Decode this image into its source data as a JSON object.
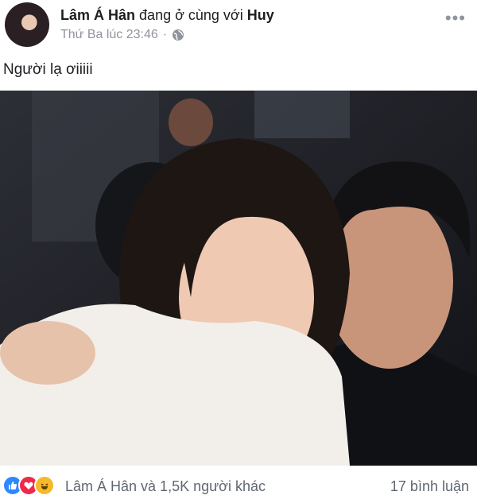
{
  "post": {
    "author": "Lâm Á Hân",
    "activity": "đang ở cùng với",
    "tagged": "Huy",
    "timestamp": "Thứ Ba lúc 23:46",
    "separator": "·",
    "privacy_icon": "globe-icon",
    "more_label": "•••",
    "text": "Người lạ ơiiiii"
  },
  "footer": {
    "reaction_icons": [
      "like-icon",
      "love-icon",
      "haha-icon"
    ],
    "reactions_summary": "Lâm Á Hân và 1,5K người khác",
    "comments": "17 bình luận"
  },
  "colors": {
    "like": "#2d88ff",
    "love": "#f0284a",
    "haha": "#f7b928",
    "meta_gray": "#90949c"
  }
}
